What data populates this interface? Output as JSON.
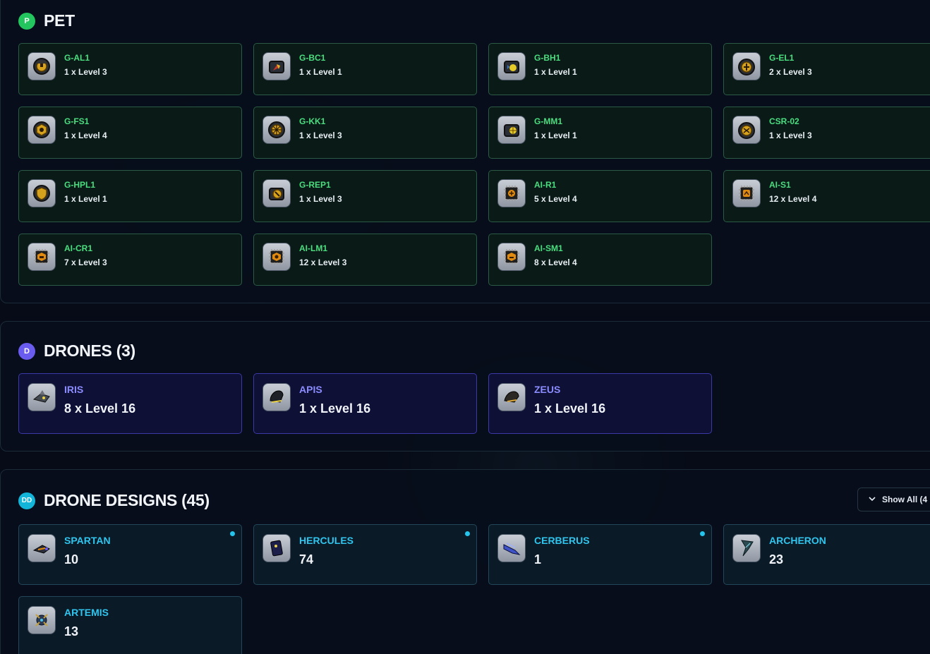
{
  "pet": {
    "badge": "P",
    "title": "PET",
    "items": [
      {
        "name": "G-AL1",
        "level": "1 x Level 3",
        "icon": "gear-pet-icon"
      },
      {
        "name": "G-BC1",
        "level": "1 x Level 1",
        "icon": "gear-pet-icon"
      },
      {
        "name": "G-BH1",
        "level": "1 x Level 1",
        "icon": "gear-pet-icon"
      },
      {
        "name": "G-EL1",
        "level": "2 x Level 3",
        "icon": "gear-pet-icon"
      },
      {
        "name": "G-FS1",
        "level": "1 x Level 4",
        "icon": "gear-pet-icon"
      },
      {
        "name": "G-KK1",
        "level": "1 x Level 3",
        "icon": "gear-pet-icon"
      },
      {
        "name": "G-MM1",
        "level": "1 x Level 1",
        "icon": "gear-pet-icon"
      },
      {
        "name": "CSR-02",
        "level": "1 x Level 3",
        "icon": "gear-pet-icon"
      },
      {
        "name": "G-HPL1",
        "level": "1 x Level 1",
        "icon": "gear-pet-icon"
      },
      {
        "name": "G-REP1",
        "level": "1 x Level 3",
        "icon": "gear-pet-icon"
      },
      {
        "name": "AI-R1",
        "level": "5 x Level 4",
        "icon": "ai-chip-icon"
      },
      {
        "name": "AI-S1",
        "level": "12 x Level 4",
        "icon": "ai-chip-icon"
      },
      {
        "name": "AI-CR1",
        "level": "7 x Level 3",
        "icon": "ai-chip-icon"
      },
      {
        "name": "AI-LM1",
        "level": "12 x Level 3",
        "icon": "ai-chip-icon"
      },
      {
        "name": "AI-SM1",
        "level": "8 x Level 4",
        "icon": "ai-chip-icon"
      }
    ]
  },
  "drones": {
    "badge": "D",
    "title": "DRONES (3)",
    "items": [
      {
        "name": "IRIS",
        "level": "8 x Level 16",
        "icon": "drone-icon"
      },
      {
        "name": "APIS",
        "level": "1 x Level 16",
        "icon": "drone-icon"
      },
      {
        "name": "ZEUS",
        "level": "1 x Level 16",
        "icon": "drone-icon"
      }
    ]
  },
  "designs": {
    "badge": "DD",
    "title": "DRONE DESIGNS (45)",
    "show_all_label": "Show All (4",
    "items": [
      {
        "name": "SPARTAN",
        "count": "10",
        "is_new": true,
        "icon": "drone-design-icon"
      },
      {
        "name": "HERCULES",
        "count": "74",
        "is_new": true,
        "icon": "drone-design-icon"
      },
      {
        "name": "CERBERUS",
        "count": "1",
        "is_new": true,
        "icon": "drone-design-icon"
      },
      {
        "name": "ARCHERON",
        "count": "23",
        "is_new": false,
        "icon": "drone-design-icon"
      },
      {
        "name": "ARTEMIS",
        "count": "13",
        "is_new": false,
        "icon": "drone-design-icon"
      }
    ]
  },
  "colors": {
    "pet_accent": "#4ade80",
    "drone_accent": "#8b8cff",
    "design_accent": "#2fc5ee",
    "background": "#060b17"
  }
}
